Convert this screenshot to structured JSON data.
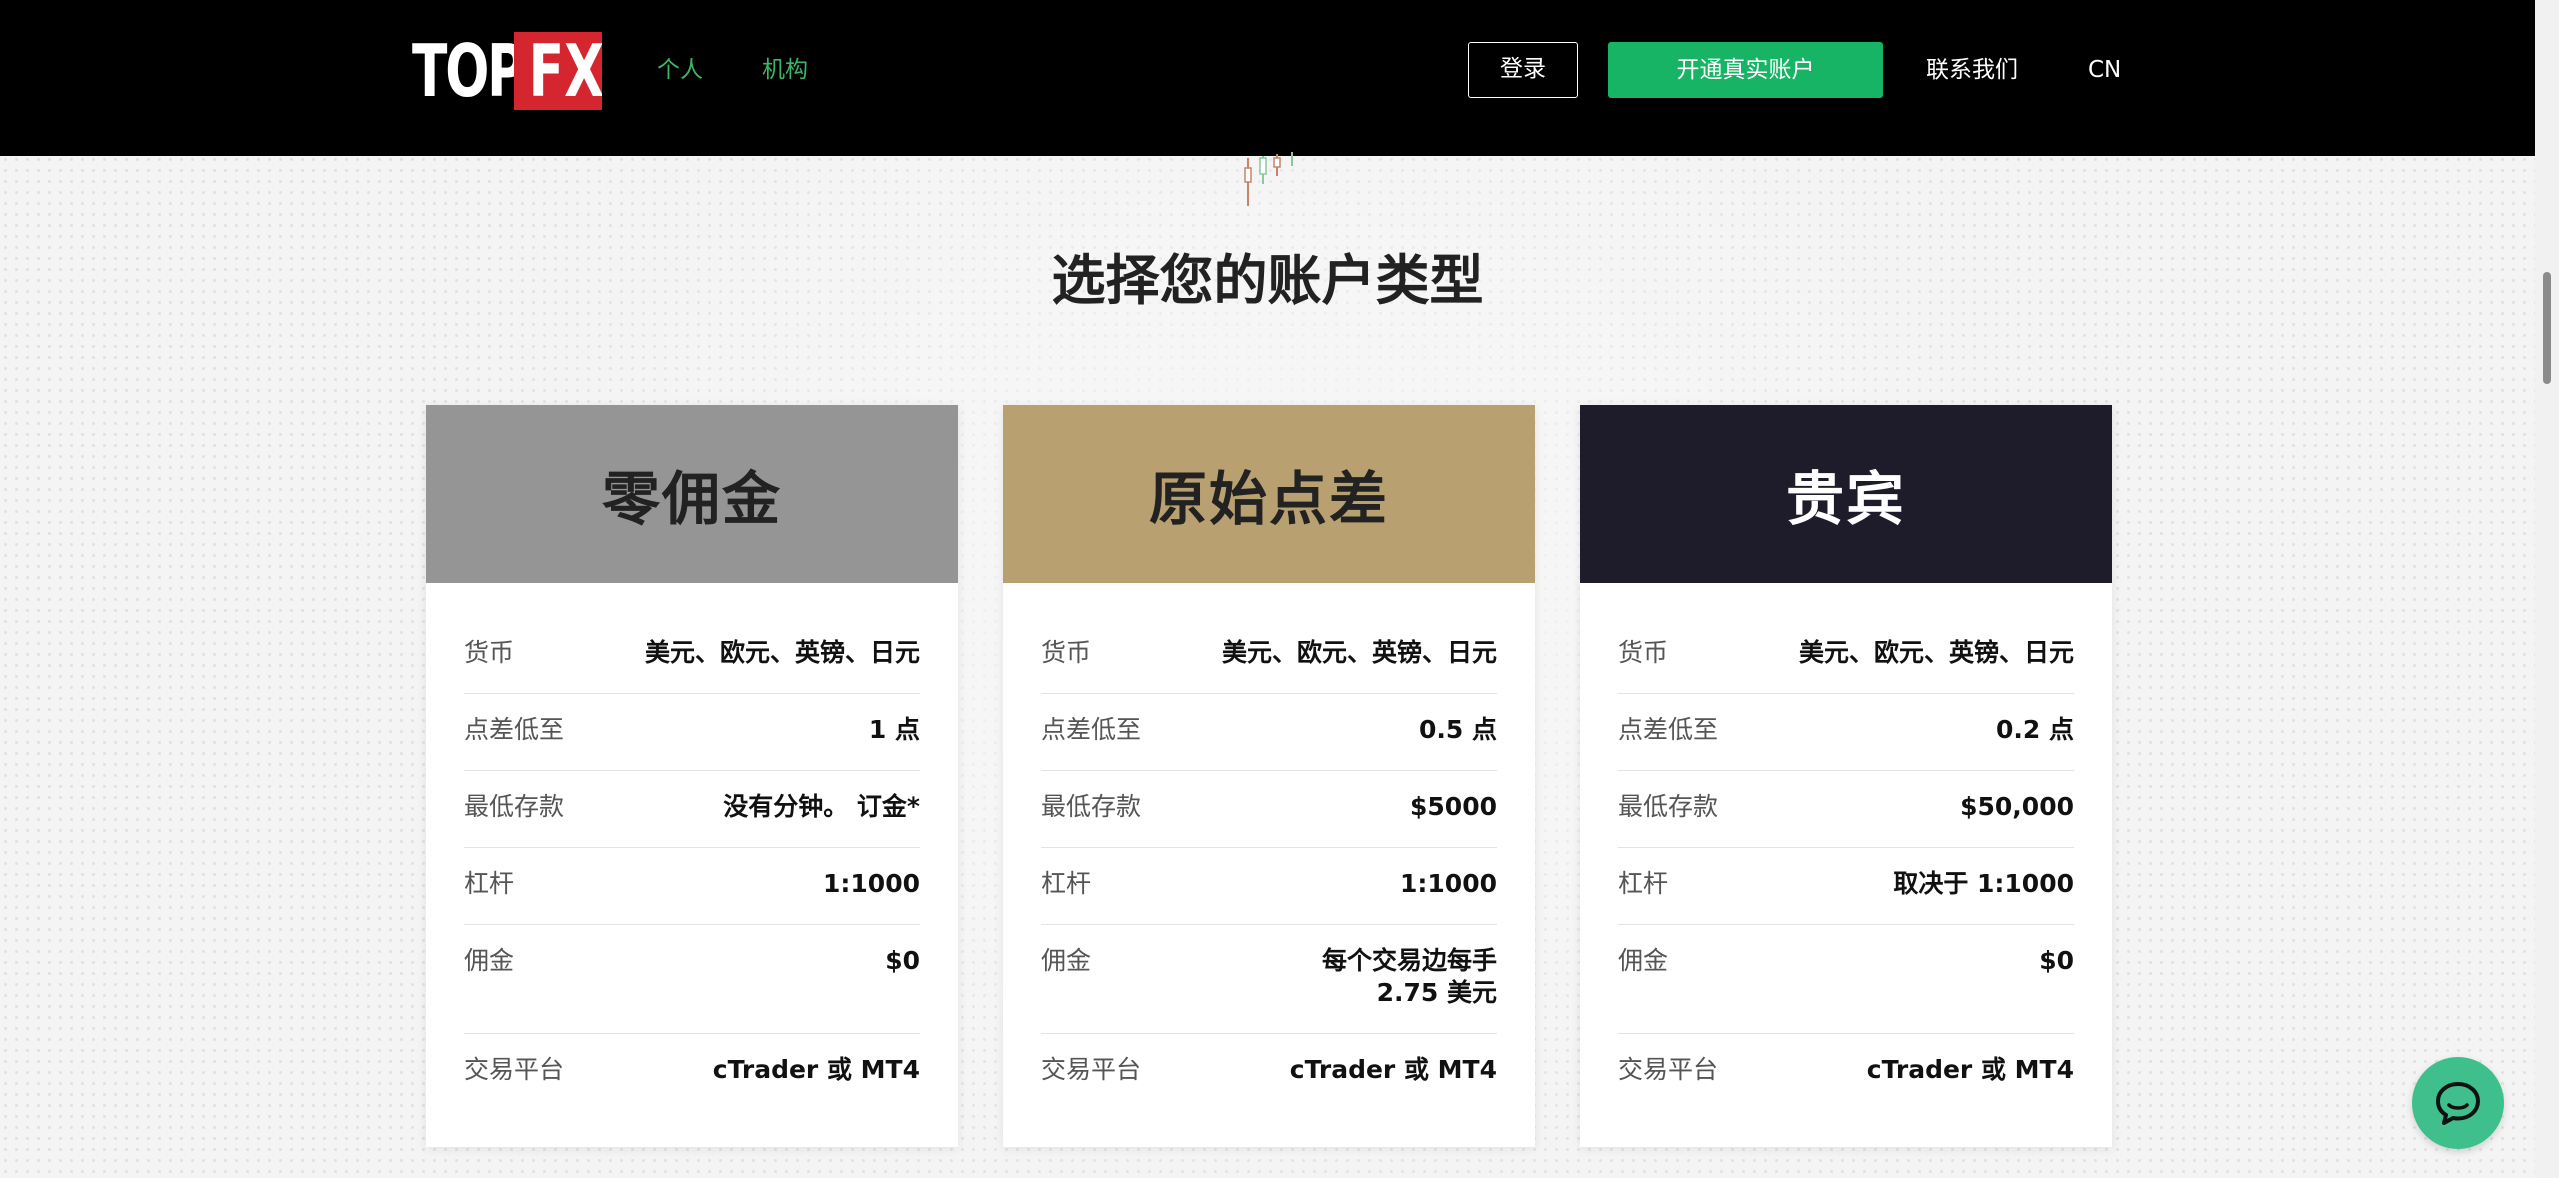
{
  "header": {
    "logo_top": "TOP",
    "logo_fx": "FX",
    "nav": [
      {
        "label": "个人"
      },
      {
        "label": "机构"
      }
    ],
    "login_label": "登录",
    "open_account_label": "开通真实账户",
    "contact_label": "联系我们",
    "language_label": "CN"
  },
  "section": {
    "title": "选择您的账户类型"
  },
  "cards": [
    {
      "name": "零佣金",
      "header_color": "#959595",
      "header_text_color": "#222222",
      "rows": [
        {
          "label": "货币",
          "value": "美元、欧元、英镑、日元"
        },
        {
          "label": "点差低至",
          "value": "1 点"
        },
        {
          "label": "最低存款",
          "value": "没有分钟。 订金*"
        },
        {
          "label": "杠杆",
          "value": "1:1000"
        },
        {
          "label": "佣金",
          "value": "$0"
        },
        {
          "label": "交易平台",
          "value": "cTrader 或 MT4"
        }
      ]
    },
    {
      "name": "原始点差",
      "header_color": "#b9a070",
      "header_text_color": "#222222",
      "rows": [
        {
          "label": "货币",
          "value": "美元、欧元、英镑、日元"
        },
        {
          "label": "点差低至",
          "value": "0.5 点"
        },
        {
          "label": "最低存款",
          "value": "$5000"
        },
        {
          "label": "杠杆",
          "value": "1:1000"
        },
        {
          "label": "佣金",
          "value": "每个交易边每手\n2.75 美元"
        },
        {
          "label": "交易平台",
          "value": "cTrader 或 MT4"
        }
      ]
    },
    {
      "name": "贵宾",
      "header_color": "#1e1c2a",
      "header_text_color": "#ffffff",
      "rows": [
        {
          "label": "货币",
          "value": "美元、欧元、英镑、日元"
        },
        {
          "label": "点差低至",
          "value": "0.2 点"
        },
        {
          "label": "最低存款",
          "value": "$50,000"
        },
        {
          "label": "杠杆",
          "value": "取决于 1:1000"
        },
        {
          "label": "佣金",
          "value": "$0"
        },
        {
          "label": "交易平台",
          "value": "cTrader 或 MT4"
        }
      ]
    }
  ],
  "colors": {
    "accent_green": "#16b464",
    "nav_green": "#3bb56a",
    "logo_red": "#d5252e",
    "chat_green": "#3fbf8c"
  },
  "icons": {
    "chat": "chat-bubble-icon",
    "candles": "candlestick-icon"
  }
}
